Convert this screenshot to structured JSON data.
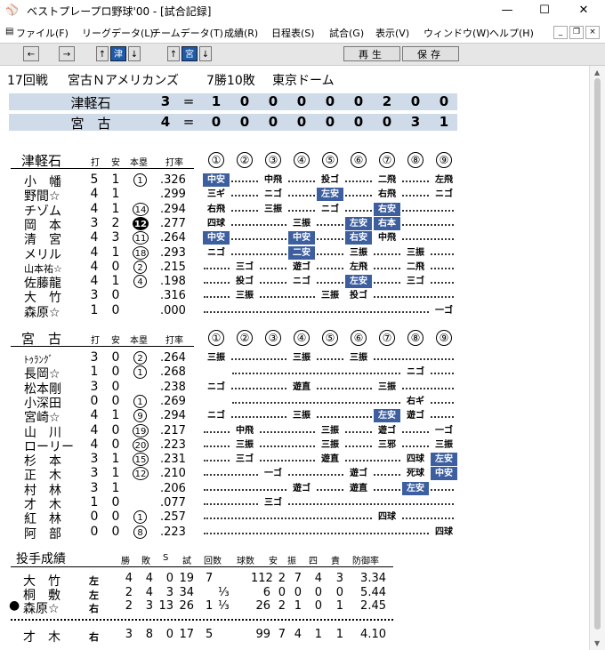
{
  "window": {
    "title": "ベストプレープロ野球'00 - [試合記録]",
    "minimize": "—",
    "maximize": "☐",
    "close": "✕"
  },
  "menu": [
    "ファイル(F)",
    "リーグデータ(L)",
    "チームデータ(T)",
    "成績(R)",
    "日程表(S)",
    "試合(G)",
    "表示(V)",
    "ウィンドウ(W)",
    "ヘルプ(H)"
  ],
  "toolbar": {
    "left": "←",
    "right": "→",
    "up": "↑",
    "down": "↓",
    "team1": "津",
    "team2": "宮",
    "play": "再生",
    "save": "保存"
  },
  "game": {
    "round": "17回戦",
    "matchup": "宮古Ｎアメリカンズ",
    "record": "7勝10敗",
    "venue": "東京ドーム"
  },
  "score": {
    "eq": "=",
    "rows": [
      {
        "team": "津軽石",
        "total": "3",
        "innings": [
          "1",
          "0",
          "0",
          "0",
          "0",
          "0",
          "2",
          "0",
          "0"
        ]
      },
      {
        "team": "宮　古",
        "total": "4",
        "innings": [
          "0",
          "0",
          "0",
          "0",
          "0",
          "0",
          "0",
          "3",
          "1"
        ]
      }
    ]
  },
  "inning_labels": [
    "①",
    "②",
    "③",
    "④",
    "⑤",
    "⑥",
    "⑦",
    "⑧",
    "⑨"
  ],
  "batting_headers": {
    "ab": "打",
    "h": "安",
    "hr": "本塁",
    "avg": "打率"
  },
  "away": {
    "team": "津軽石",
    "players": [
      {
        "name": "小　幡",
        "ab": "5",
        "h": "1",
        "hr": "1",
        "avg": ".326",
        "res": [
          [
            "中安",
            "h"
          ],
          [
            "",
            ""
          ],
          [
            "中飛",
            ""
          ],
          [
            "",
            ""
          ],
          [
            "投ゴ",
            ""
          ],
          [
            "",
            ""
          ],
          [
            "二飛",
            ""
          ],
          [
            "",
            ""
          ],
          [
            "左飛",
            ""
          ]
        ],
        "start": 0
      },
      {
        "name": "野間☆",
        "ab": "4",
        "h": "1",
        "hr": "",
        "avg": ".299",
        "res": [
          [
            "三ギ",
            ""
          ],
          [
            "",
            ""
          ],
          [
            "ニゴ",
            ""
          ],
          [
            "",
            ""
          ],
          [
            "左安",
            "h"
          ],
          [
            "",
            ""
          ],
          [
            "右飛",
            ""
          ],
          [
            "",
            ""
          ],
          [
            "ニゴ",
            ""
          ]
        ],
        "start": 0
      },
      {
        "name": "チゾム",
        "ab": "4",
        "h": "1",
        "hr": "14",
        "avg": ".294",
        "res": [
          [
            "右飛",
            ""
          ],
          [
            "",
            ""
          ],
          [
            "三振",
            ""
          ],
          [
            "",
            ""
          ],
          [
            "ニゴ",
            ""
          ],
          [
            "",
            ""
          ],
          [
            "右安",
            "h"
          ],
          [
            "",
            ""
          ],
          [
            "",
            ""
          ]
        ],
        "start": 0
      },
      {
        "name": "岡　本",
        "ab": "3",
        "h": "2",
        "hr": "12",
        "avg": ".277",
        "hrFilled": true,
        "res": [
          [
            "四球",
            ""
          ],
          [
            "",
            ""
          ],
          [
            "",
            ""
          ],
          [
            "三振",
            ""
          ],
          [
            "",
            ""
          ],
          [
            "左安",
            "h"
          ],
          [
            "右本",
            "h"
          ],
          [
            "",
            ""
          ],
          [
            "",
            ""
          ]
        ],
        "start": 0
      },
      {
        "name": "清　宮",
        "ab": "4",
        "h": "3",
        "hr": "11",
        "avg": ".264",
        "res": [
          [
            "中安",
            "h"
          ],
          [
            "",
            ""
          ],
          [
            "",
            ""
          ],
          [
            "中安",
            "h"
          ],
          [
            "",
            ""
          ],
          [
            "右安",
            "h"
          ],
          [
            "中飛",
            ""
          ],
          [
            "",
            ""
          ],
          [
            "",
            ""
          ]
        ],
        "start": 0
      },
      {
        "name": "メリル",
        "ab": "4",
        "h": "1",
        "hr": "18",
        "avg": ".293",
        "res": [
          [
            "ニゴ",
            ""
          ],
          [
            "",
            ""
          ],
          [
            "",
            ""
          ],
          [
            "二安",
            "h"
          ],
          [
            "",
            ""
          ],
          [
            "三振",
            ""
          ],
          [
            "",
            ""
          ],
          [
            "三振",
            ""
          ],
          [
            "",
            ""
          ]
        ],
        "start": 0
      },
      {
        "name": "山本祐☆",
        "ab": "4",
        "h": "0",
        "hr": "2",
        "avg": ".215",
        "small": true,
        "res": [
          [
            "",
            ""
          ],
          [
            "三ゴ",
            ""
          ],
          [
            "",
            ""
          ],
          [
            "遊ゴ",
            ""
          ],
          [
            "",
            ""
          ],
          [
            "左飛",
            ""
          ],
          [
            "",
            ""
          ],
          [
            "二飛",
            ""
          ],
          [
            "",
            ""
          ]
        ],
        "start": 0
      },
      {
        "name": "佐藤龍",
        "ab": "4",
        "h": "1",
        "hr": "4",
        "avg": ".198",
        "res": [
          [
            "",
            ""
          ],
          [
            "投ゴ",
            ""
          ],
          [
            "",
            ""
          ],
          [
            "ニゴ",
            ""
          ],
          [
            "",
            ""
          ],
          [
            "左安",
            "h"
          ],
          [
            "",
            ""
          ],
          [
            "三ゴ",
            ""
          ],
          [
            "",
            ""
          ]
        ],
        "start": 0
      },
      {
        "name": "大　竹",
        "ab": "3",
        "h": "0",
        "hr": "",
        "avg": ".316",
        "res": [
          [
            "",
            ""
          ],
          [
            "三振",
            ""
          ],
          [
            "",
            ""
          ],
          [
            "",
            ""
          ],
          [
            "三振",
            ""
          ],
          [
            "投ゴ",
            ""
          ],
          [
            "",
            ""
          ],
          [
            "",
            ""
          ],
          [
            "",
            ""
          ]
        ],
        "start": 0
      },
      {
        "name": "森原☆",
        "ab": "1",
        "h": "0",
        "hr": "",
        "avg": ".000",
        "res": [
          [
            "",
            ""
          ],
          [
            "",
            ""
          ],
          [
            "",
            ""
          ],
          [
            "",
            ""
          ],
          [
            "",
            ""
          ],
          [
            "",
            ""
          ],
          [
            "",
            ""
          ],
          [
            "",
            ""
          ],
          [
            "一ゴ",
            ""
          ]
        ],
        "start": 0
      }
    ]
  },
  "home": {
    "team": "宮　古",
    "players": [
      {
        "name": "ﾄｩﾗﾝｸﾞ",
        "ab": "3",
        "h": "0",
        "hr": "2",
        "avg": ".264",
        "small": true,
        "res": [
          [
            "三振",
            ""
          ],
          [
            "",
            ""
          ],
          [
            "",
            ""
          ],
          [
            "三振",
            ""
          ],
          [
            "",
            ""
          ],
          [
            "三振",
            ""
          ],
          [
            "",
            ""
          ],
          [
            "",
            ""
          ],
          [
            "",
            ""
          ]
        ],
        "start": 0
      },
      {
        "name": "長岡☆",
        "ab": "1",
        "h": "0",
        "hr": "1",
        "avg": ".268",
        "res": [
          [
            "",
            ""
          ],
          [
            "",
            ""
          ],
          [
            "",
            ""
          ],
          [
            "",
            ""
          ],
          [
            "",
            ""
          ],
          [
            "",
            ""
          ],
          [
            "",
            ""
          ],
          [
            "ニゴ",
            ""
          ],
          [
            "",
            ""
          ]
        ],
        "start": 1
      },
      {
        "name": "松本剛",
        "ab": "3",
        "h": "0",
        "hr": "",
        "avg": ".238",
        "res": [
          [
            "ニゴ",
            ""
          ],
          [
            "",
            ""
          ],
          [
            "",
            ""
          ],
          [
            "遊直",
            ""
          ],
          [
            "",
            ""
          ],
          [
            "",
            ""
          ],
          [
            "三振",
            ""
          ],
          [
            "",
            ""
          ],
          [
            "",
            ""
          ]
        ],
        "start": 0
      },
      {
        "name": "小深田",
        "ab": "0",
        "h": "0",
        "hr": "1",
        "avg": ".269",
        "res": [
          [
            "",
            ""
          ],
          [
            "",
            ""
          ],
          [
            "",
            ""
          ],
          [
            "",
            ""
          ],
          [
            "",
            ""
          ],
          [
            "",
            ""
          ],
          [
            "",
            ""
          ],
          [
            "右ギ",
            ""
          ],
          [
            "",
            ""
          ]
        ],
        "start": 1
      },
      {
        "name": "宮崎☆",
        "ab": "4",
        "h": "1",
        "hr": "9",
        "avg": ".294",
        "res": [
          [
            "ニゴ",
            ""
          ],
          [
            "",
            ""
          ],
          [
            "",
            ""
          ],
          [
            "三振",
            ""
          ],
          [
            "",
            ""
          ],
          [
            "",
            ""
          ],
          [
            "左安",
            "h"
          ],
          [
            "遊ゴ",
            ""
          ],
          [
            "",
            ""
          ]
        ],
        "start": 0
      },
      {
        "name": "山　川",
        "ab": "4",
        "h": "0",
        "hr": "19",
        "avg": ".217",
        "res": [
          [
            "",
            ""
          ],
          [
            "中飛",
            ""
          ],
          [
            "",
            ""
          ],
          [
            "",
            ""
          ],
          [
            "三振",
            ""
          ],
          [
            "",
            ""
          ],
          [
            "遊ゴ",
            ""
          ],
          [
            "",
            ""
          ],
          [
            "一ゴ",
            ""
          ]
        ],
        "start": 0
      },
      {
        "name": "ローリー",
        "ab": "4",
        "h": "0",
        "hr": "20",
        "avg": ".223",
        "res": [
          [
            "",
            ""
          ],
          [
            "三振",
            ""
          ],
          [
            "",
            ""
          ],
          [
            "",
            ""
          ],
          [
            "三振",
            ""
          ],
          [
            "",
            ""
          ],
          [
            "三邪",
            ""
          ],
          [
            "",
            ""
          ],
          [
            "三振",
            ""
          ]
        ],
        "start": 0
      },
      {
        "name": "杉　本",
        "ab": "3",
        "h": "1",
        "hr": "15",
        "avg": ".231",
        "res": [
          [
            "",
            ""
          ],
          [
            "三ゴ",
            ""
          ],
          [
            "",
            ""
          ],
          [
            "",
            ""
          ],
          [
            "遊直",
            ""
          ],
          [
            "",
            ""
          ],
          [
            "",
            ""
          ],
          [
            "四球",
            ""
          ],
          [
            "左安",
            "h"
          ]
        ],
        "start": 0
      },
      {
        "name": "正　木",
        "ab": "3",
        "h": "1",
        "hr": "12",
        "avg": ".210",
        "res": [
          [
            "",
            ""
          ],
          [
            "",
            ""
          ],
          [
            "一ゴ",
            ""
          ],
          [
            "",
            ""
          ],
          [
            "",
            ""
          ],
          [
            "遊ゴ",
            ""
          ],
          [
            "",
            ""
          ],
          [
            "死球",
            ""
          ],
          [
            "中安",
            "h"
          ]
        ],
        "start": 0
      },
      {
        "name": "村　林",
        "ab": "3",
        "h": "1",
        "hr": "",
        "avg": ".206",
        "res": [
          [
            "",
            ""
          ],
          [
            "",
            ""
          ],
          [
            "",
            ""
          ],
          [
            "遊ゴ",
            ""
          ],
          [
            "",
            ""
          ],
          [
            "遊直",
            ""
          ],
          [
            "",
            ""
          ],
          [
            "左安",
            "h"
          ],
          [
            "",
            ""
          ]
        ],
        "start": 0
      },
      {
        "name": "才　木",
        "ab": "1",
        "h": "0",
        "hr": "",
        "avg": ".077",
        "res": [
          [
            "",
            ""
          ],
          [
            "",
            ""
          ],
          [
            "三ゴ",
            ""
          ],
          [
            "",
            ""
          ],
          [
            "",
            ""
          ],
          [
            "",
            ""
          ],
          [
            "",
            ""
          ],
          [
            "",
            ""
          ],
          [
            "",
            ""
          ]
        ],
        "start": 0
      },
      {
        "name": "紅　林",
        "ab": "0",
        "h": "0",
        "hr": "1",
        "avg": ".257",
        "res": [
          [
            "",
            ""
          ],
          [
            "",
            ""
          ],
          [
            "",
            ""
          ],
          [
            "",
            ""
          ],
          [
            "",
            ""
          ],
          [
            "",
            ""
          ],
          [
            "四球",
            ""
          ],
          [
            "",
            ""
          ],
          [
            "",
            ""
          ]
        ],
        "start": 0
      },
      {
        "name": "阿　部",
        "ab": "0",
        "h": "0",
        "hr": "8",
        "avg": ".223",
        "res": [
          [
            "",
            ""
          ],
          [
            "",
            ""
          ],
          [
            "",
            ""
          ],
          [
            "",
            ""
          ],
          [
            "",
            ""
          ],
          [
            "",
            ""
          ],
          [
            "",
            ""
          ],
          [
            "",
            ""
          ],
          [
            "四球",
            ""
          ]
        ],
        "start": 0
      }
    ]
  },
  "pitching": {
    "title": "投手成績",
    "headers": [
      "勝",
      "敗",
      "S",
      "試",
      "回数",
      "球数",
      "安",
      "振",
      "四",
      "責",
      "防御率"
    ],
    "rows": [
      {
        "marker": "",
        "name": "大　竹",
        "hand": "左",
        "w": "4",
        "l": "4",
        "s": "0",
        "g": "19",
        "ip": "7",
        "ipf": "",
        "pc": "112",
        "h": "2",
        "k": "7",
        "bb": "4",
        "er": "3",
        "era": "3.34"
      },
      {
        "marker": "",
        "name": "桐　敷",
        "hand": "左",
        "w": "2",
        "l": "4",
        "s": "3",
        "g": "34",
        "ip": "",
        "ipf": "⅓",
        "pc": "6",
        "h": "0",
        "k": "0",
        "bb": "0",
        "er": "0",
        "era": "5.44"
      },
      {
        "marker": "●",
        "name": "森原☆",
        "hand": "右",
        "w": "2",
        "l": "3",
        "s": "13",
        "g": "26",
        "ip": "1",
        "ipf": "⅓",
        "pc": "26",
        "h": "2",
        "k": "1",
        "bb": "0",
        "er": "1",
        "era": "2.45"
      },
      {
        "marker": "",
        "name": "才　木",
        "hand": "右",
        "w": "3",
        "l": "8",
        "s": "0",
        "g": "17",
        "ip": "5",
        "ipf": "",
        "pc": "99",
        "h": "7",
        "k": "4",
        "bb": "1",
        "er": "1",
        "era": "4.10"
      }
    ]
  }
}
